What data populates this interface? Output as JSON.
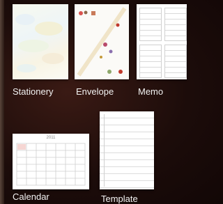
{
  "templates": [
    {
      "label": "Stationery"
    },
    {
      "label": "Envelope"
    },
    {
      "label": "Memo"
    },
    {
      "label": "Calendar"
    },
    {
      "label": "Template"
    }
  ],
  "calendar_header": "2011",
  "colors": {
    "label_text": "#f2f2f2",
    "background_dark": "#1c0c0a",
    "paper_white": "#ffffff",
    "accent_red": "#c0392b"
  }
}
